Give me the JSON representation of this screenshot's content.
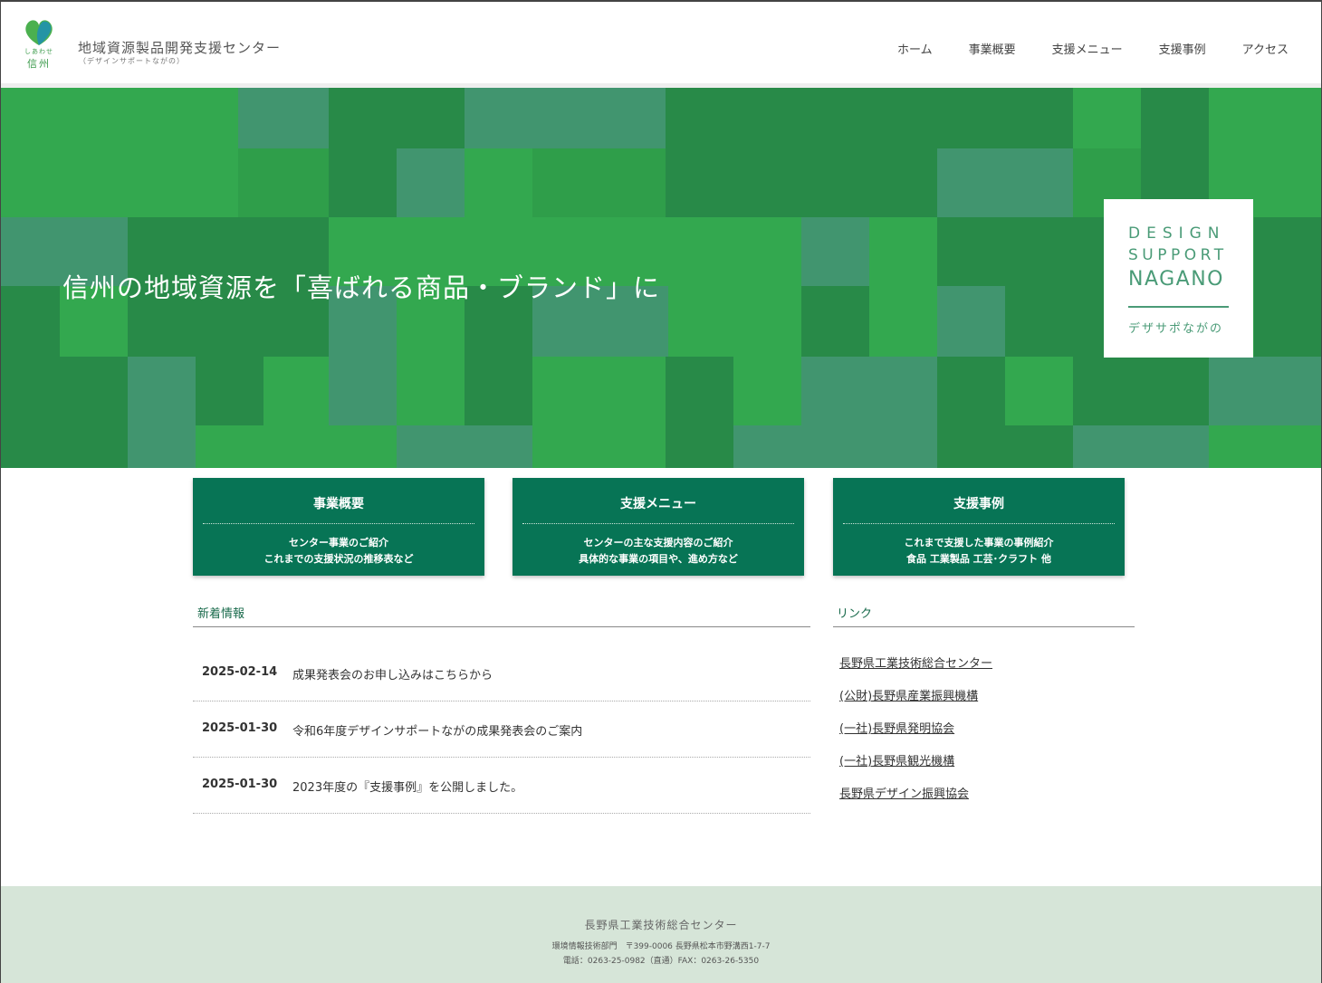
{
  "header": {
    "logo_caption": "しあわせ",
    "logo_caption2": "信州",
    "site_title": "地域資源製品開発支援センター",
    "site_subtitle": "（デザインサポートながの）",
    "nav": [
      "ホーム",
      "事業概要",
      "支援メニュー",
      "支援事例",
      "アクセス"
    ]
  },
  "hero": {
    "tagline": "信州の地域資源を「喜ばれる商品・ブランド」に",
    "badge": {
      "line1": "DESIGN",
      "line2": "SUPPORT",
      "line3": "NAGANO",
      "line4": "デザサポながの"
    },
    "colors": {
      "base": "#2f9e4a",
      "dark": "#288a48",
      "teal": "#41956f",
      "bright": "#33a84f"
    }
  },
  "cards": [
    {
      "title": "事業概要",
      "desc1": "センター事業のご紹介",
      "desc2": "これまでの支援状況の推移表など"
    },
    {
      "title": "支援メニュー",
      "desc1": "センターの主な支援内容のご紹介",
      "desc2": "具体的な事業の項目や、進め方など"
    },
    {
      "title": "支援事例",
      "desc1": "これまで支援した事業の事例紹介",
      "desc2": "食品 工業製品 工芸･クラフト 他"
    }
  ],
  "news": {
    "title": "新着情報",
    "items": [
      {
        "date": "2025-02-14",
        "text": "成果発表会のお申し込みはこちらから"
      },
      {
        "date": "2025-01-30",
        "text": "令和6年度デザインサポートながの成果発表会のご案内"
      },
      {
        "date": "2025-01-30",
        "text": "2023年度の『支援事例』を公開しました。"
      }
    ]
  },
  "links": {
    "title": "リンク",
    "items": [
      "長野県工業技術総合センター",
      "(公財)長野県産業振興機構",
      "(一社)長野県発明協会",
      "(一社)長野県観光機構",
      "長野県デザイン振興協会"
    ]
  },
  "footer": {
    "org": "長野県工業技術総合センター",
    "address": "環境情報技術部門　〒399-0006 長野県松本市野溝西1-7-7",
    "phone": "電話：0263-25-0982（直通）FAX：0263-26-5350"
  }
}
